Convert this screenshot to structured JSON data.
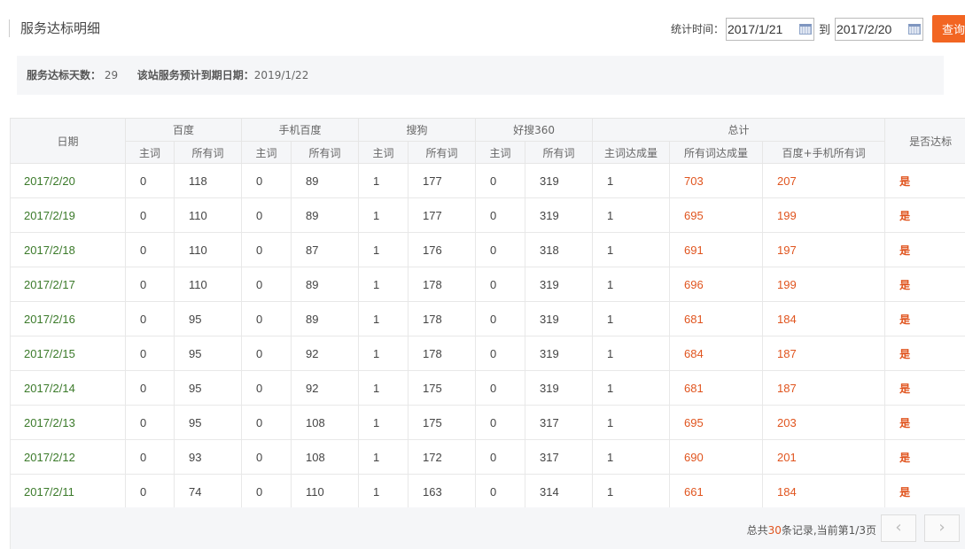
{
  "page": {
    "title": "服务达标明细"
  },
  "filter": {
    "label": "统计时间：",
    "start_date": "2017/1/21",
    "to_label": "到",
    "end_date": "2017/2/20",
    "query_label": "查询"
  },
  "summary": {
    "days_label": "服务达标天数：",
    "days_value": "29",
    "expire_label": "该站服务预计到期日期：",
    "expire_value": "2019/1/22"
  },
  "table": {
    "group_headers": {
      "date": "日期",
      "baidu": "百度",
      "mobile_baidu": "手机百度",
      "sogou": "搜狗",
      "haosou": "好搜360",
      "total": "总计",
      "reached": "是否达标"
    },
    "sub_headers": {
      "main": "主词",
      "all": "所有词",
      "main_reached": "主词达成量",
      "all_reached": "所有词达成量",
      "baidu_mobile_all": "百度+手机所有词"
    },
    "rows": [
      [
        "2017/2/20",
        "0",
        "118",
        "0",
        "89",
        "1",
        "177",
        "0",
        "319",
        "1",
        "703",
        "207",
        "是"
      ],
      [
        "2017/2/19",
        "0",
        "110",
        "0",
        "89",
        "1",
        "177",
        "0",
        "319",
        "1",
        "695",
        "199",
        "是"
      ],
      [
        "2017/2/18",
        "0",
        "110",
        "0",
        "87",
        "1",
        "176",
        "0",
        "318",
        "1",
        "691",
        "197",
        "是"
      ],
      [
        "2017/2/17",
        "0",
        "110",
        "0",
        "89",
        "1",
        "178",
        "0",
        "319",
        "1",
        "696",
        "199",
        "是"
      ],
      [
        "2017/2/16",
        "0",
        "95",
        "0",
        "89",
        "1",
        "178",
        "0",
        "319",
        "1",
        "681",
        "184",
        "是"
      ],
      [
        "2017/2/15",
        "0",
        "95",
        "0",
        "92",
        "1",
        "178",
        "0",
        "319",
        "1",
        "684",
        "187",
        "是"
      ],
      [
        "2017/2/14",
        "0",
        "95",
        "0",
        "92",
        "1",
        "175",
        "0",
        "319",
        "1",
        "681",
        "187",
        "是"
      ],
      [
        "2017/2/13",
        "0",
        "95",
        "0",
        "108",
        "1",
        "175",
        "0",
        "317",
        "1",
        "695",
        "203",
        "是"
      ],
      [
        "2017/2/12",
        "0",
        "93",
        "0",
        "108",
        "1",
        "172",
        "0",
        "317",
        "1",
        "690",
        "201",
        "是"
      ],
      [
        "2017/2/11",
        "0",
        "74",
        "0",
        "110",
        "1",
        "163",
        "0",
        "314",
        "1",
        "661",
        "184",
        "是"
      ]
    ]
  },
  "pager": {
    "prefix": "总共",
    "total": "30",
    "suffix": "条记录,当前第1/3页",
    "prev_icon": "chevron-left-icon",
    "next_icon": "chevron-right-icon"
  }
}
